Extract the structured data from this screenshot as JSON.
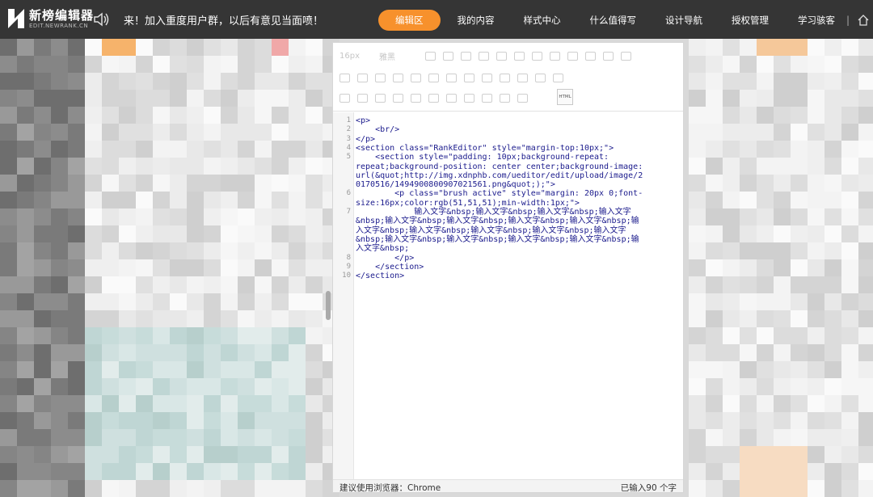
{
  "app": {
    "brand": "新榜编辑器",
    "brand_sub": "EDIT.NEWRANK.CN",
    "announcement": "来！加入重度用户群，以后有意见当面喷！"
  },
  "nav": {
    "items": [
      {
        "label": "编辑区",
        "active": true
      },
      {
        "label": "我的内容"
      },
      {
        "label": "样式中心"
      },
      {
        "label": "什么值得写"
      },
      {
        "label": "设计导航"
      },
      {
        "label": "授权管理"
      },
      {
        "label": "学习骇客"
      }
    ],
    "separator": "|"
  },
  "toolbar": {
    "font_size": "16px",
    "font_family": "雅黑",
    "html_label": "HTML"
  },
  "code": {
    "line_numbers": [
      "1",
      "2",
      "3",
      "4",
      "5",
      "6",
      "7",
      "8",
      "9",
      "10"
    ],
    "lines": [
      "<p>",
      "    <br/>",
      "</p>",
      "<section class=\"RankEditor\" style=\"margin-top:10px;\">",
      "    <section style=\"padding: 10px;background-repeat:",
      "repeat;background-position: center center;background-image:",
      "url(&quot;http://img.xdnphb.com/ueditor/edit/upload/image/2",
      "0170516/1494900800907021561.png&quot;);\">",
      "        <p class=\"brush active\" style=\"margin: 20px 0;font-",
      "size:16px;color:rgb(51,51,51);min-width:1px;\">",
      "            输入文字&nbsp;输入文字&nbsp;输入文字&nbsp;输入文字",
      "&nbsp;输入文字&nbsp;输入文字&nbsp;输入文字&nbsp;输入文字&nbsp;输",
      "入文字&nbsp;输入文字&nbsp;输入文字&nbsp;输入文字&nbsp;输入文字",
      "&nbsp;输入文字&nbsp;输入文字&nbsp;输入文字&nbsp;输入文字&nbsp;输",
      "入文字&nbsp;",
      "        </p>",
      "    </section>",
      "</section>"
    ]
  },
  "status": {
    "browser_hint": "建议使用浏览器：Chrome",
    "char_count": "已输入90 个字"
  },
  "colors": {
    "topbar": "#353535",
    "accent": "#f7912c",
    "code_blue": "#1a1a8c"
  }
}
